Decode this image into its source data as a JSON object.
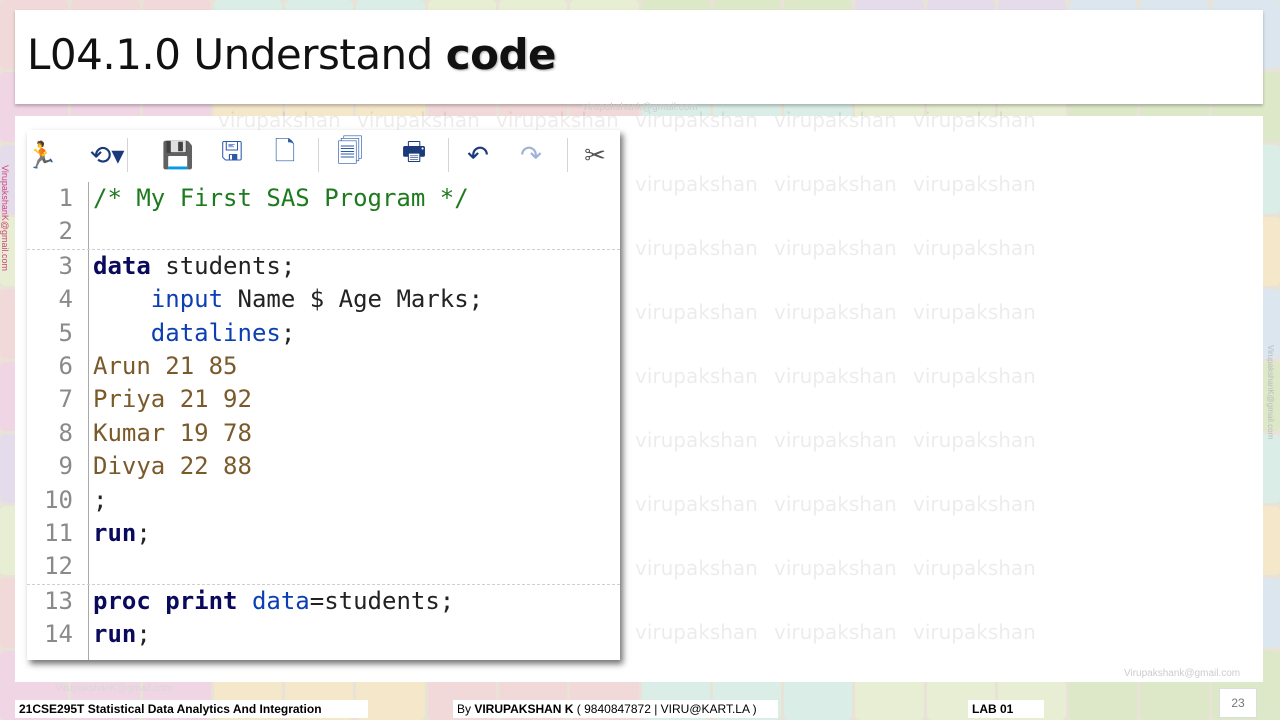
{
  "slide": {
    "title_prefix": "L04.1.0 Understand ",
    "title_bold": "code",
    "watermark_text": "virupakshan",
    "side_email": "VirupakshanK@gmail.com",
    "corner_email": "Virupakshank@gmail.com",
    "center_email": "virupakshank@gmail.com",
    "footer_email": "VirupakshanK@gmail.com"
  },
  "editor": {
    "toolbar": [
      {
        "name": "run-icon",
        "glyph": "🏃"
      },
      {
        "name": "history-icon",
        "glyph": "⟲▾"
      },
      {
        "name": "save-icon",
        "glyph": "💾"
      },
      {
        "name": "save-as-icon",
        "glyph": "🖫"
      },
      {
        "name": "new-file-icon",
        "glyph": "🗋"
      },
      {
        "name": "log-icon",
        "glyph": "🗐"
      },
      {
        "name": "print-icon",
        "glyph": "🖶"
      },
      {
        "name": "undo-icon",
        "glyph": "↶"
      },
      {
        "name": "redo-icon",
        "glyph": "↷"
      },
      {
        "name": "cut-icon",
        "glyph": "✂"
      }
    ],
    "lines": [
      {
        "n": "1",
        "segments": [
          {
            "c": "cm",
            "t": "/* My First SAS Program */"
          }
        ]
      },
      {
        "n": "2",
        "segments": []
      },
      {
        "n": "3",
        "dashed": true,
        "segments": [
          {
            "c": "kw",
            "t": "data"
          },
          {
            "c": "pl",
            "t": " students;"
          }
        ]
      },
      {
        "n": "4",
        "segments": [
          {
            "c": "pl",
            "t": "    "
          },
          {
            "c": "kb",
            "t": "input"
          },
          {
            "c": "pl",
            "t": " Name $ Age Marks;"
          }
        ]
      },
      {
        "n": "5",
        "segments": [
          {
            "c": "pl",
            "t": "    "
          },
          {
            "c": "kb",
            "t": "datalines"
          },
          {
            "c": "pl",
            "t": ";"
          }
        ]
      },
      {
        "n": "6",
        "segments": [
          {
            "c": "dt",
            "t": "Arun 21 85"
          }
        ]
      },
      {
        "n": "7",
        "segments": [
          {
            "c": "dt",
            "t": "Priya 21 92"
          }
        ]
      },
      {
        "n": "8",
        "segments": [
          {
            "c": "dt",
            "t": "Kumar 19 78"
          }
        ]
      },
      {
        "n": "9",
        "segments": [
          {
            "c": "dt",
            "t": "Divya 22 88"
          }
        ]
      },
      {
        "n": "10",
        "segments": [
          {
            "c": "pl",
            "t": ";"
          }
        ]
      },
      {
        "n": "11",
        "segments": [
          {
            "c": "kw",
            "t": "run"
          },
          {
            "c": "pl",
            "t": ";"
          }
        ]
      },
      {
        "n": "12",
        "segments": []
      },
      {
        "n": "13",
        "dashed": true,
        "segments": [
          {
            "c": "kw",
            "t": "proc print"
          },
          {
            "c": "pl",
            "t": " "
          },
          {
            "c": "kb",
            "t": "data"
          },
          {
            "c": "pl",
            "t": "=students;"
          }
        ]
      },
      {
        "n": "14",
        "segments": [
          {
            "c": "kw",
            "t": "run"
          },
          {
            "c": "pl",
            "t": ";"
          }
        ]
      }
    ]
  },
  "footer": {
    "course": "21CSE295T Statistical Data Analytics And Integration",
    "by_prefix": "By ",
    "author": "VIRUPAKSHAN K",
    "contact": " ( 9840847872 | VIRU@KART.LA )",
    "lab": "LAB  01",
    "page": "23"
  }
}
